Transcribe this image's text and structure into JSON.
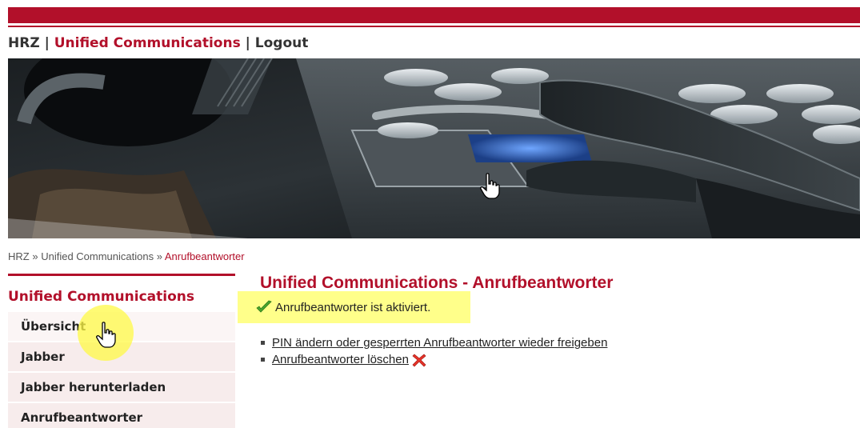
{
  "topnav": {
    "hrz": "HRZ",
    "sep1": "|",
    "uc": "Unified Communications",
    "sep2": "|",
    "logout": "Logout"
  },
  "banner": {
    "icon": "desk-phone-photo"
  },
  "breadcrumb": {
    "hrz": "HRZ",
    "sep1": "»",
    "uc": "Unified Communications",
    "sep2": "»",
    "current": "Anrufbeantworter"
  },
  "sidebar": {
    "title": "Unified Communications",
    "items": [
      {
        "label": "Übersicht"
      },
      {
        "label": "Jabber"
      },
      {
        "label": "Jabber herunterladen"
      },
      {
        "label": "Anrufbeantworter"
      }
    ]
  },
  "main": {
    "heading": "Unified Communications - Anrufbeantworter",
    "status": "Anrufbeantworter ist aktiviert.",
    "status_icon": "check-icon",
    "links": [
      {
        "label": "PIN ändern oder gesperrten Anrufbeantworter wieder freigeben"
      },
      {
        "label": "Anrufbeantworter löschen",
        "icon": "delete-x-icon"
      }
    ]
  },
  "colors": {
    "brand": "#b2102a",
    "highlight": "#ffff8a",
    "sidebar_bg": "#f7ecec"
  }
}
